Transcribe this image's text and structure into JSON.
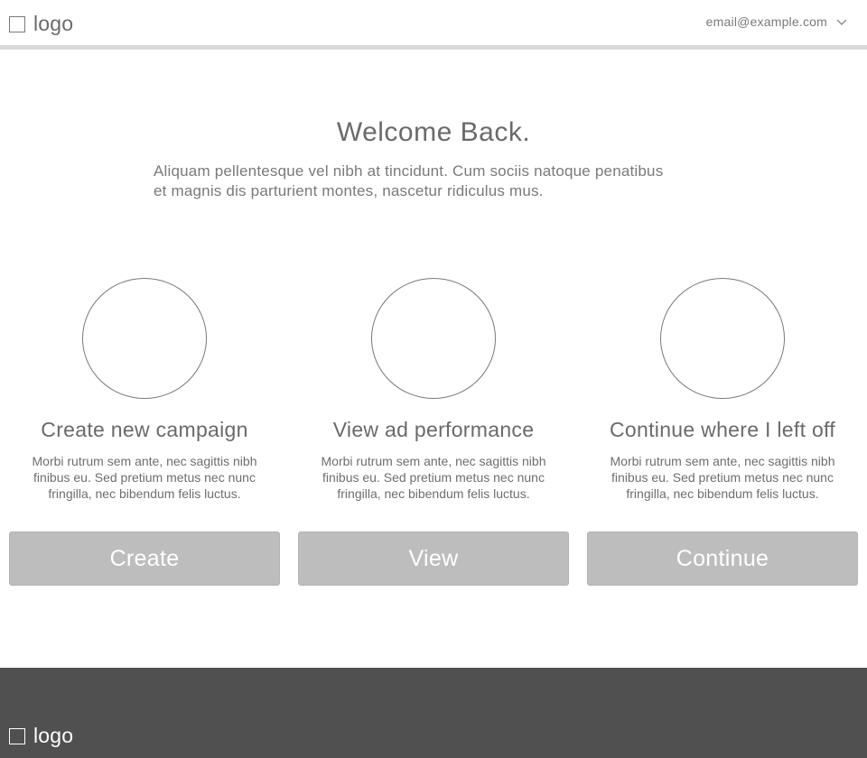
{
  "header": {
    "logo_text": "logo",
    "account_email": "email@example.com"
  },
  "hero": {
    "title": "Welcome Back.",
    "subtitle_line1": "Aliquam pellentesque vel nibh at tincidunt. Cum sociis natoque penatibus",
    "subtitle_line2": "et magnis dis parturient montes, nascetur ridiculus mus."
  },
  "columns": [
    {
      "title": "Create new campaign",
      "description": "Morbi rutrum sem ante, nec sagittis nibh finibus eu. Sed pretium metus nec nunc fringilla, nec bibendum felis luctus.",
      "button_label": "Create"
    },
    {
      "title": "View ad performance",
      "description": "Morbi rutrum sem ante, nec sagittis nibh finibus eu. Sed pretium metus nec nunc fringilla, nec bibendum felis luctus.",
      "button_label": "View"
    },
    {
      "title": "Continue where I left off",
      "description": "Morbi rutrum sem ante, nec sagittis nibh finibus eu. Sed pretium metus nec nunc fringilla, nec bibendum felis luctus.",
      "button_label": "Continue"
    }
  ],
  "footer": {
    "logo_text": "logo"
  },
  "icons": {
    "logo": "square-outline-icon",
    "account_menu": "chevron-down-icon",
    "column_image": "circle-placeholder-icon"
  },
  "colors": {
    "button_bg": "#bdbdbd",
    "footer_bg": "#505050",
    "header_rule": "#d9d9d9",
    "text": "#6a6a6a"
  }
}
